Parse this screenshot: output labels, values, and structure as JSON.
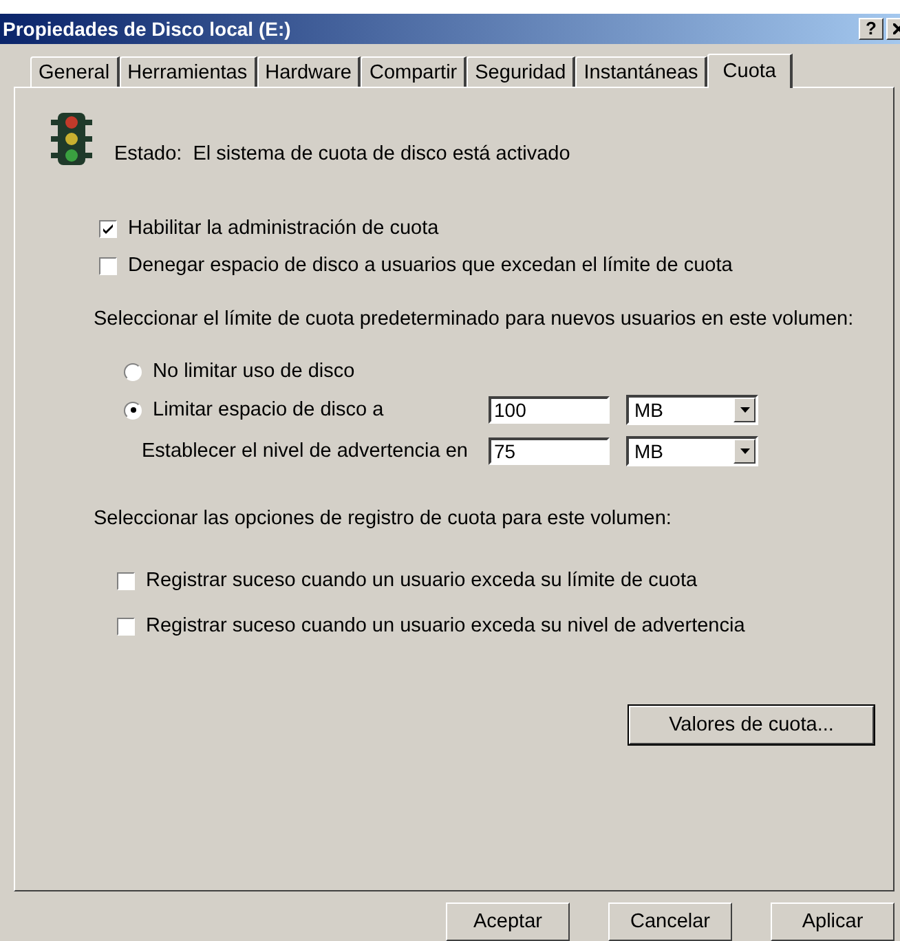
{
  "window": {
    "title": "Propiedades de Disco local (E:)",
    "help_button": "?"
  },
  "tabs": [
    {
      "label": "General",
      "selected": false
    },
    {
      "label": "Herramientas",
      "selected": false
    },
    {
      "label": "Hardware",
      "selected": false
    },
    {
      "label": "Compartir",
      "selected": false
    },
    {
      "label": "Seguridad",
      "selected": false
    },
    {
      "label": "Instantáneas",
      "selected": false
    },
    {
      "label": "Cuota",
      "selected": true
    }
  ],
  "status": {
    "label": "Estado:",
    "text": "El sistema de cuota de disco está activado"
  },
  "quota_options": [
    {
      "label": "Habilitar la administración de cuota",
      "checked": true
    },
    {
      "label": "Denegar espacio de disco a usuarios que excedan el límite de cuota",
      "checked": false
    }
  ],
  "limit_section": {
    "label": "Seleccionar el límite de cuota predeterminado para nuevos usuarios en este volumen:",
    "radios": [
      {
        "label": "No limitar uso de disco",
        "selected": false
      },
      {
        "label": "Limitar espacio de disco a",
        "selected": true
      }
    ],
    "limit": {
      "value": "100",
      "unit": "MB"
    },
    "warning": {
      "label": "Establecer el nivel de advertencia en",
      "value": "75",
      "unit": "MB"
    }
  },
  "log_section": {
    "label": "Seleccionar las opciones de registro de cuota para este volumen:",
    "options": [
      {
        "label": "Registrar suceso cuando un usuario exceda su límite de cuota",
        "checked": false
      },
      {
        "label": "Registrar suceso cuando un usuario exceda su nivel de advertencia",
        "checked": false
      }
    ]
  },
  "values_button": "Valores de cuota...",
  "buttons": [
    "Aceptar",
    "Cancelar",
    "Aplicar"
  ]
}
